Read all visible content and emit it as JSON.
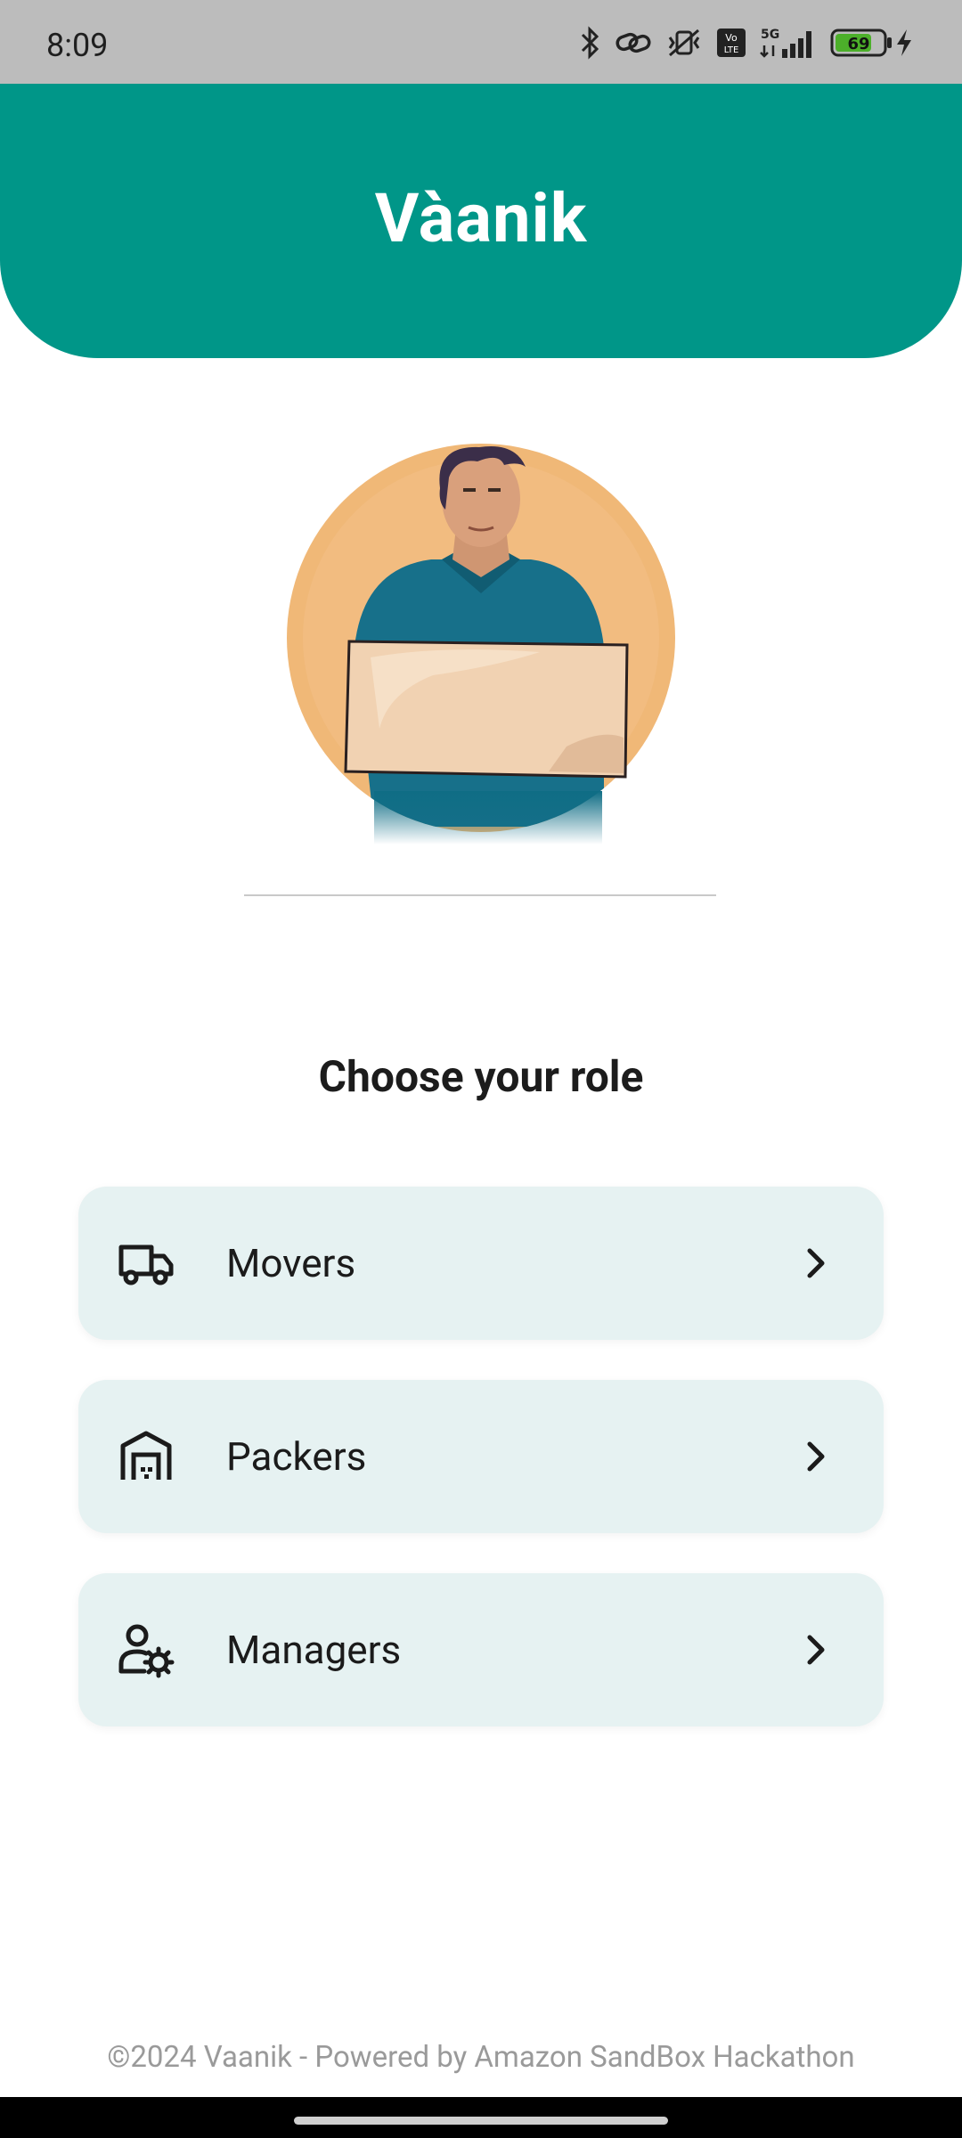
{
  "status_bar": {
    "time": "8:09",
    "battery_level": "69",
    "network": "5G"
  },
  "header": {
    "title": "Vàanik"
  },
  "illustration": {
    "icon": "delivery-man-holding-box"
  },
  "roles": {
    "heading": "Choose your role",
    "items": [
      {
        "label": "Movers",
        "icon": "truck-icon"
      },
      {
        "label": "Packers",
        "icon": "warehouse-icon"
      },
      {
        "label": "Managers",
        "icon": "user-gear-icon"
      }
    ]
  },
  "footer": {
    "text": "©2024 Vaanik - Powered by Amazon SandBox Hackathon"
  },
  "colors": {
    "primary": "#009688",
    "card_bg": "#e6f2f2",
    "illustration_circle": "#f0b877"
  }
}
